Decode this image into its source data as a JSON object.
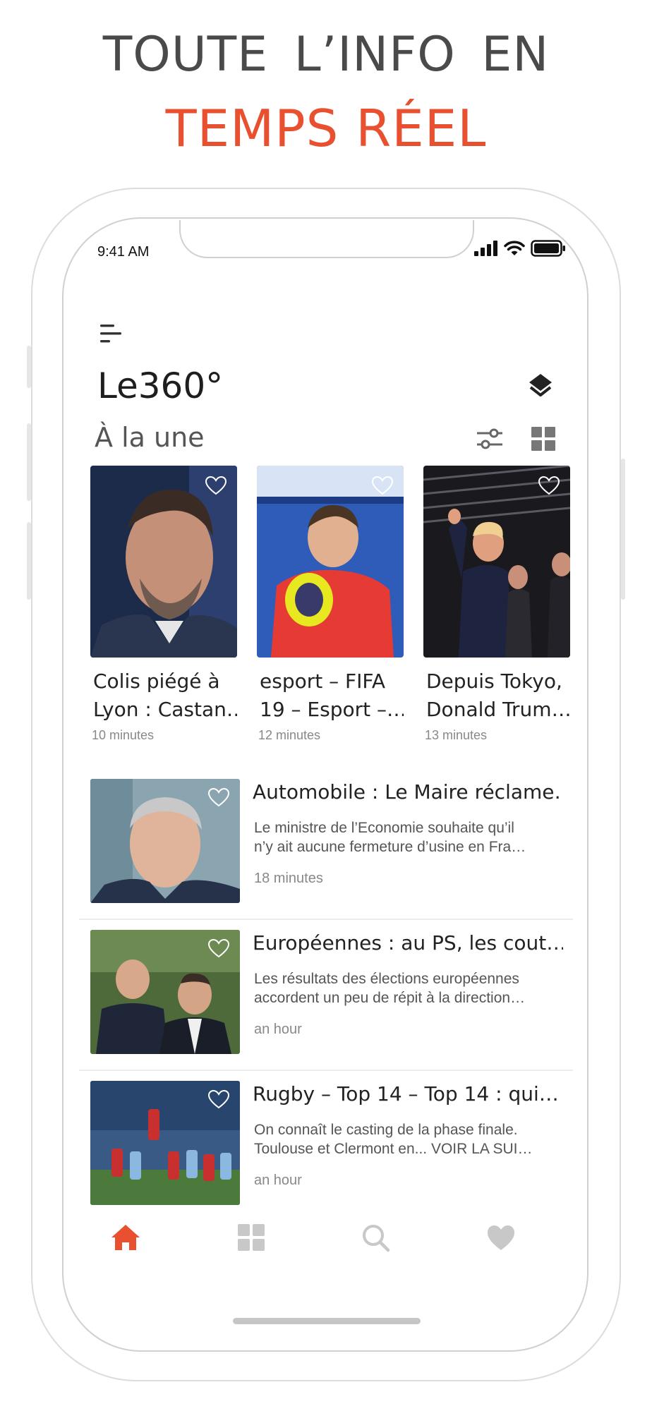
{
  "promo": {
    "line1": "TOUTE  L’INFO  EN",
    "line2": "TEMPS RÉEL",
    "line1_color": "#4a4a4a",
    "line2_color": "#e8502f"
  },
  "status_bar": {
    "time": "9:41 AM",
    "icons": [
      "cellular-signal-icon",
      "wifi-icon",
      "battery-icon"
    ]
  },
  "header": {
    "app_name": "Le360°",
    "section": "À la une",
    "icons": [
      "menu-icon",
      "layers-icon",
      "filter-sliders-icon",
      "grid-view-icon"
    ]
  },
  "featured": [
    {
      "title_line1": "Colis piégé à",
      "title_line2": "Lyon : Castan…",
      "time": "10 minutes",
      "favorite": false
    },
    {
      "title_line1": "esport – FIFA",
      "title_line2": "19 – Esport –…",
      "time": "12 minutes",
      "favorite": false
    },
    {
      "title_line1": "Depuis Tokyo,",
      "title_line2": "Donald Trum…",
      "time": "13 minutes",
      "favorite": false
    }
  ],
  "articles": [
    {
      "title": "Automobile : Le Maire réclame…",
      "desc_line1": "Le ministre de l’Economie souhaite qu’il",
      "desc_line2": "n’y ait aucune fermeture d’usine en Fra…",
      "time": "18 minutes",
      "favorite": false
    },
    {
      "title": "Européennes : au PS, les cout…",
      "desc_line1": "Les résultats des élections européennes",
      "desc_line2": "accordent un peu de répit à la direction…",
      "time": "an hour",
      "favorite": false
    },
    {
      "title": "Rugby – Top 14 – Top 14 : qui…",
      "desc_line1": "On connaît le casting de la phase finale.",
      "desc_line2": "Toulouse et Clermont en... VOIR LA SUI…",
      "time": "an hour",
      "favorite": false
    }
  ],
  "tabbar": {
    "active": "home",
    "tabs": [
      "home-icon",
      "categories-grid-icon",
      "search-icon",
      "favorites-heart-icon"
    ],
    "active_color": "#e8502f",
    "inactive_color": "#c8c8c8"
  }
}
